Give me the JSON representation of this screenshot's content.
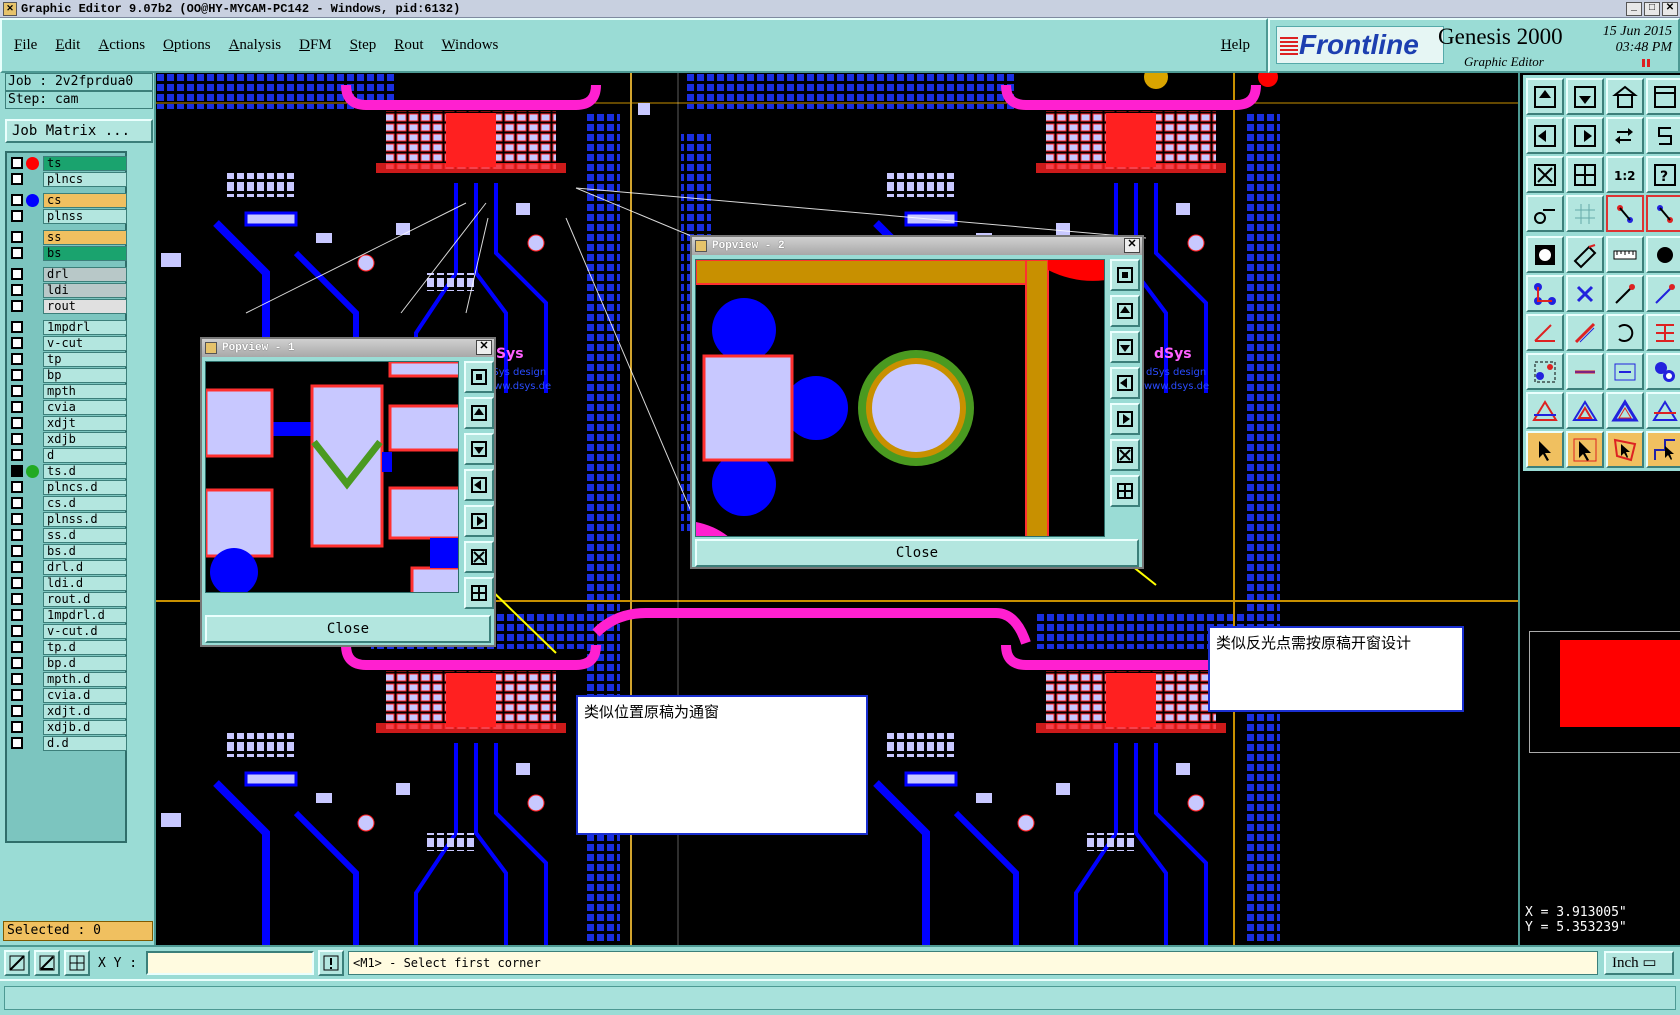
{
  "window": {
    "title": "Graphic Editor 9.07b2 (OO@HY-MYCAM-PC142 - Windows, pid:6132)"
  },
  "menu": {
    "items": [
      "File",
      "Edit",
      "Actions",
      "Options",
      "Analysis",
      "DFM",
      "Step",
      "Rout",
      "Windows"
    ],
    "help": "Help"
  },
  "brand": {
    "logo": "Frontline",
    "product": "Genesis 2000",
    "subtitle": "Graphic Editor",
    "date": "15 Jun 2015",
    "time": "03:48 PM"
  },
  "job": {
    "job_label": "Job : 2v2fprdua0",
    "step_label": "Step: cam",
    "matrix_button": "Job Matrix ..."
  },
  "layers": [
    {
      "name": "ts",
      "color": "#1aa36e",
      "dot": "#ff0000",
      "checked": false
    },
    {
      "name": "plncs",
      "color": "#b3e6df",
      "dot": "",
      "checked": false
    },
    {
      "name": "cs",
      "color": "#f0c060",
      "dot": "#0000ff",
      "checked": false
    },
    {
      "name": "plnss",
      "color": "#b3e6df",
      "dot": "",
      "checked": false
    },
    {
      "name": "ss",
      "color": "#f0c060",
      "dot": "",
      "checked": false
    },
    {
      "name": "bs",
      "color": "#1aa36e",
      "dot": "",
      "checked": false
    },
    {
      "name": "drl",
      "color": "#b8c8c8",
      "dot": "",
      "checked": false
    },
    {
      "name": "ldi",
      "color": "#b8c8c8",
      "dot": "",
      "checked": false
    },
    {
      "name": "rout",
      "color": "#e0e0e0",
      "dot": "",
      "checked": false
    },
    {
      "name": "1mpdrl",
      "color": "#b3e6df",
      "dot": "",
      "checked": false
    },
    {
      "name": "v-cut",
      "color": "#b3e6df",
      "dot": "",
      "checked": false
    },
    {
      "name": "tp",
      "color": "#b3e6df",
      "dot": "",
      "checked": false
    },
    {
      "name": "bp",
      "color": "#b3e6df",
      "dot": "",
      "checked": false
    },
    {
      "name": "mpth",
      "color": "#b3e6df",
      "dot": "",
      "checked": false
    },
    {
      "name": "cvia",
      "color": "#b3e6df",
      "dot": "",
      "checked": false
    },
    {
      "name": "xdjt",
      "color": "#b3e6df",
      "dot": "",
      "checked": false
    },
    {
      "name": "xdjb",
      "color": "#b3e6df",
      "dot": "",
      "checked": false
    },
    {
      "name": "d",
      "color": "#b3e6df",
      "dot": "",
      "checked": false
    },
    {
      "name": "ts.d",
      "color": "#b3e6df",
      "dot": "#22aa22",
      "checked": true
    },
    {
      "name": "plncs.d",
      "color": "#b3e6df",
      "dot": "",
      "checked": false
    },
    {
      "name": "cs.d",
      "color": "#b3e6df",
      "dot": "",
      "checked": false
    },
    {
      "name": "plnss.d",
      "color": "#b3e6df",
      "dot": "",
      "checked": false
    },
    {
      "name": "ss.d",
      "color": "#b3e6df",
      "dot": "",
      "checked": false
    },
    {
      "name": "bs.d",
      "color": "#b3e6df",
      "dot": "",
      "checked": false
    },
    {
      "name": "drl.d",
      "color": "#b3e6df",
      "dot": "",
      "checked": false
    },
    {
      "name": "ldi.d",
      "color": "#b3e6df",
      "dot": "",
      "checked": false
    },
    {
      "name": "rout.d",
      "color": "#b3e6df",
      "dot": "",
      "checked": false
    },
    {
      "name": "1mpdrl.d",
      "color": "#b3e6df",
      "dot": "",
      "checked": false
    },
    {
      "name": "v-cut.d",
      "color": "#b3e6df",
      "dot": "",
      "checked": false
    },
    {
      "name": "tp.d",
      "color": "#b3e6df",
      "dot": "",
      "checked": false
    },
    {
      "name": "bp.d",
      "color": "#b3e6df",
      "dot": "",
      "checked": false
    },
    {
      "name": "mpth.d",
      "color": "#b3e6df",
      "dot": "",
      "checked": false
    },
    {
      "name": "cvia.d",
      "color": "#b3e6df",
      "dot": "",
      "checked": false
    },
    {
      "name": "xdjt.d",
      "color": "#b3e6df",
      "dot": "",
      "checked": false
    },
    {
      "name": "xdjb.d",
      "color": "#b3e6df",
      "dot": "",
      "checked": false
    },
    {
      "name": "d.d",
      "color": "#b3e6df",
      "dot": "",
      "checked": false
    }
  ],
  "selected": "Selected : 0",
  "popview1": {
    "title": "Popview - 1",
    "close": "Close"
  },
  "popview2": {
    "title": "Popview - 2",
    "close": "Close"
  },
  "callouts": {
    "left": "类似位置原稿为通窗",
    "right": "类似反光点需按原稿开窗设计"
  },
  "board_text": {
    "logo": "dSys",
    "design": "dSys design",
    "url": "www.dsys.de"
  },
  "coords": {
    "x": "X = 3.913005\"",
    "y": "Y = 5.353239\""
  },
  "status": {
    "xy_label": "X Y :",
    "xy_value": "",
    "prompt": "<M1> - Select first corner",
    "unit": "Inch"
  },
  "colors": {
    "panel": "#9adcd5",
    "copper_pad": "#c8c8ff",
    "trace": "#0000ff",
    "mask": "#ff20d0",
    "board_outline": "#c89000"
  }
}
